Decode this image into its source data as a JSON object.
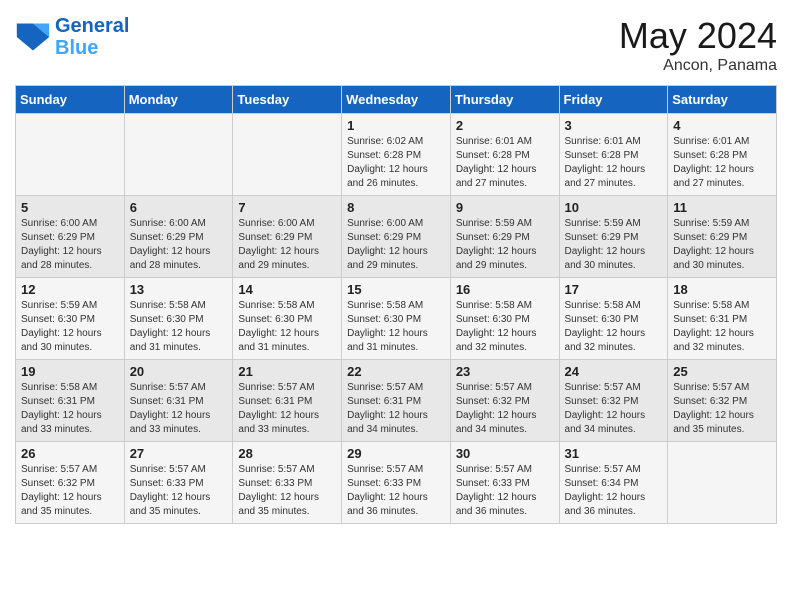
{
  "header": {
    "logo_line1": "General",
    "logo_line2": "Blue",
    "month": "May 2024",
    "location": "Ancon, Panama"
  },
  "days_of_week": [
    "Sunday",
    "Monday",
    "Tuesday",
    "Wednesday",
    "Thursday",
    "Friday",
    "Saturday"
  ],
  "weeks": [
    [
      {
        "day": "",
        "info": ""
      },
      {
        "day": "",
        "info": ""
      },
      {
        "day": "",
        "info": ""
      },
      {
        "day": "1",
        "info": "Sunrise: 6:02 AM\nSunset: 6:28 PM\nDaylight: 12 hours\nand 26 minutes."
      },
      {
        "day": "2",
        "info": "Sunrise: 6:01 AM\nSunset: 6:28 PM\nDaylight: 12 hours\nand 27 minutes."
      },
      {
        "day": "3",
        "info": "Sunrise: 6:01 AM\nSunset: 6:28 PM\nDaylight: 12 hours\nand 27 minutes."
      },
      {
        "day": "4",
        "info": "Sunrise: 6:01 AM\nSunset: 6:28 PM\nDaylight: 12 hours\nand 27 minutes."
      }
    ],
    [
      {
        "day": "5",
        "info": "Sunrise: 6:00 AM\nSunset: 6:29 PM\nDaylight: 12 hours\nand 28 minutes."
      },
      {
        "day": "6",
        "info": "Sunrise: 6:00 AM\nSunset: 6:29 PM\nDaylight: 12 hours\nand 28 minutes."
      },
      {
        "day": "7",
        "info": "Sunrise: 6:00 AM\nSunset: 6:29 PM\nDaylight: 12 hours\nand 29 minutes."
      },
      {
        "day": "8",
        "info": "Sunrise: 6:00 AM\nSunset: 6:29 PM\nDaylight: 12 hours\nand 29 minutes."
      },
      {
        "day": "9",
        "info": "Sunrise: 5:59 AM\nSunset: 6:29 PM\nDaylight: 12 hours\nand 29 minutes."
      },
      {
        "day": "10",
        "info": "Sunrise: 5:59 AM\nSunset: 6:29 PM\nDaylight: 12 hours\nand 30 minutes."
      },
      {
        "day": "11",
        "info": "Sunrise: 5:59 AM\nSunset: 6:29 PM\nDaylight: 12 hours\nand 30 minutes."
      }
    ],
    [
      {
        "day": "12",
        "info": "Sunrise: 5:59 AM\nSunset: 6:30 PM\nDaylight: 12 hours\nand 30 minutes."
      },
      {
        "day": "13",
        "info": "Sunrise: 5:58 AM\nSunset: 6:30 PM\nDaylight: 12 hours\nand 31 minutes."
      },
      {
        "day": "14",
        "info": "Sunrise: 5:58 AM\nSunset: 6:30 PM\nDaylight: 12 hours\nand 31 minutes."
      },
      {
        "day": "15",
        "info": "Sunrise: 5:58 AM\nSunset: 6:30 PM\nDaylight: 12 hours\nand 31 minutes."
      },
      {
        "day": "16",
        "info": "Sunrise: 5:58 AM\nSunset: 6:30 PM\nDaylight: 12 hours\nand 32 minutes."
      },
      {
        "day": "17",
        "info": "Sunrise: 5:58 AM\nSunset: 6:30 PM\nDaylight: 12 hours\nand 32 minutes."
      },
      {
        "day": "18",
        "info": "Sunrise: 5:58 AM\nSunset: 6:31 PM\nDaylight: 12 hours\nand 32 minutes."
      }
    ],
    [
      {
        "day": "19",
        "info": "Sunrise: 5:58 AM\nSunset: 6:31 PM\nDaylight: 12 hours\nand 33 minutes."
      },
      {
        "day": "20",
        "info": "Sunrise: 5:57 AM\nSunset: 6:31 PM\nDaylight: 12 hours\nand 33 minutes."
      },
      {
        "day": "21",
        "info": "Sunrise: 5:57 AM\nSunset: 6:31 PM\nDaylight: 12 hours\nand 33 minutes."
      },
      {
        "day": "22",
        "info": "Sunrise: 5:57 AM\nSunset: 6:31 PM\nDaylight: 12 hours\nand 34 minutes."
      },
      {
        "day": "23",
        "info": "Sunrise: 5:57 AM\nSunset: 6:32 PM\nDaylight: 12 hours\nand 34 minutes."
      },
      {
        "day": "24",
        "info": "Sunrise: 5:57 AM\nSunset: 6:32 PM\nDaylight: 12 hours\nand 34 minutes."
      },
      {
        "day": "25",
        "info": "Sunrise: 5:57 AM\nSunset: 6:32 PM\nDaylight: 12 hours\nand 35 minutes."
      }
    ],
    [
      {
        "day": "26",
        "info": "Sunrise: 5:57 AM\nSunset: 6:32 PM\nDaylight: 12 hours\nand 35 minutes."
      },
      {
        "day": "27",
        "info": "Sunrise: 5:57 AM\nSunset: 6:33 PM\nDaylight: 12 hours\nand 35 minutes."
      },
      {
        "day": "28",
        "info": "Sunrise: 5:57 AM\nSunset: 6:33 PM\nDaylight: 12 hours\nand 35 minutes."
      },
      {
        "day": "29",
        "info": "Sunrise: 5:57 AM\nSunset: 6:33 PM\nDaylight: 12 hours\nand 36 minutes."
      },
      {
        "day": "30",
        "info": "Sunrise: 5:57 AM\nSunset: 6:33 PM\nDaylight: 12 hours\nand 36 minutes."
      },
      {
        "day": "31",
        "info": "Sunrise: 5:57 AM\nSunset: 6:34 PM\nDaylight: 12 hours\nand 36 minutes."
      },
      {
        "day": "",
        "info": ""
      }
    ]
  ]
}
